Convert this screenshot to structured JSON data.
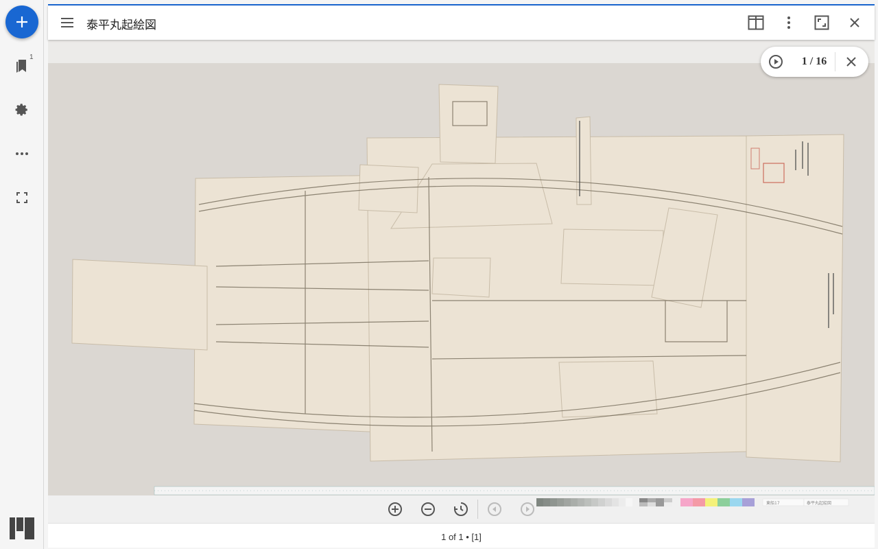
{
  "document": {
    "title": "泰平丸起絵図"
  },
  "pager": {
    "count": "1 / 16"
  },
  "status": {
    "text": "1 of 1 • [1]"
  },
  "ruler_strip": {
    "left_label": "東船17",
    "right_label": "泰平丸起絵図"
  },
  "colors": {
    "accent": "#1967d2",
    "fab_icon": "#ffffff"
  },
  "icons": {
    "fab": "plus-icon",
    "rail": [
      "bookmarks-icon",
      "gear-icon",
      "more-horizontal-icon",
      "fullscreen-icon"
    ],
    "topbar": [
      "menu-icon",
      "split-view-icon",
      "more-vertical-icon",
      "fullscreen-icon",
      "close-icon"
    ],
    "viewer": [
      "zoom-in-icon",
      "zoom-out-icon",
      "rotate-icon",
      "previous-page-icon",
      "next-page-icon"
    ]
  },
  "rail": {
    "bookmark_badge": "1"
  }
}
